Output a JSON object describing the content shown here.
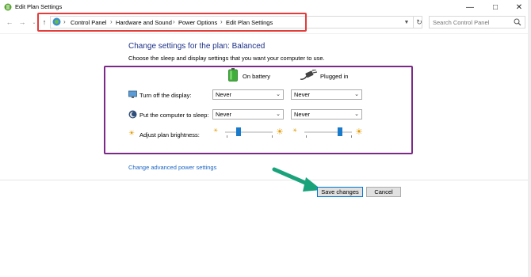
{
  "window": {
    "title": "Edit Plan Settings",
    "buttons": [
      "minimize",
      "maximize",
      "close"
    ]
  },
  "address": {
    "crumbs": [
      "Control Panel",
      "Hardware and Sound",
      "Power Options",
      "Edit Plan Settings"
    ],
    "separator": "›"
  },
  "search": {
    "placeholder": "Search Control Panel"
  },
  "plan": {
    "heading": "Change settings for the plan: Balanced",
    "subtitle": "Choose the sleep and display settings that you want your computer to use."
  },
  "columns": {
    "battery": "On battery",
    "plugged": "Plugged in"
  },
  "rows": [
    {
      "label": "Turn off the display:",
      "battery": "Never",
      "plugged": "Never"
    },
    {
      "label": "Put the computer to sleep:",
      "battery": "Never",
      "plugged": "Never"
    }
  ],
  "brightness": {
    "label": "Adjust plan brightness:",
    "battery_level_percent": 25,
    "plugged_level_percent": 78
  },
  "links": {
    "advanced": "Change advanced power settings"
  },
  "buttons": {
    "save": "Save changes",
    "cancel": "Cancel"
  },
  "colors": {
    "heading": "#1e3287",
    "link": "#1a66c2",
    "address_highlight": "#e43b3b",
    "settings_highlight": "#7b2a87",
    "slider": "#1979ca",
    "annotation_arrow": "#1aa37a"
  }
}
